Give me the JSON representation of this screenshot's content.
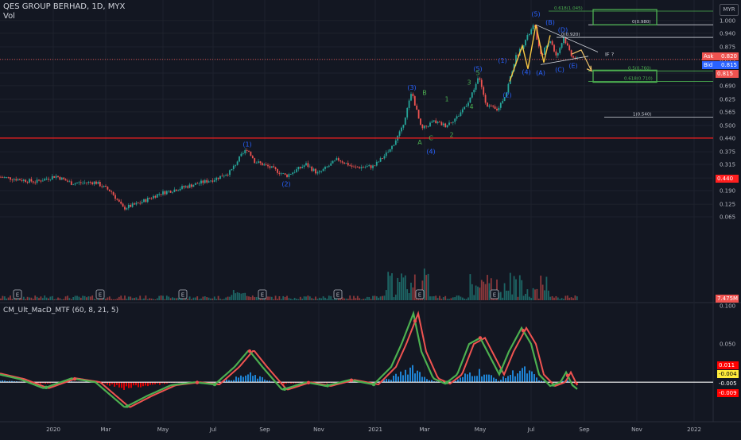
{
  "header": {
    "title": "QES GROUP BERHAD, 1D, MYX",
    "volume_label": "Vol",
    "currency": "MYR",
    "indicator_label": "CM_Ult_MacD_MTF (60, 8, 21, 5)"
  },
  "colors": {
    "background": "#131722",
    "up": "#26a69a",
    "down": "#ef5350",
    "wave_label": "#2962ff",
    "sub_wave_label": "#4caf50",
    "fib_box": "#4caf50",
    "red_line": "#ff1f1f",
    "macd_line": "#4caf50",
    "macd_signal": "#ef5350",
    "hist_up": "#2196f3",
    "hist_down": "#ff0000",
    "projection": "#f0c36a"
  },
  "price_tags": [
    {
      "label": "Ask",
      "value": "0.820",
      "color": "#ef5350"
    },
    {
      "label": "Bid",
      "value": "0.815",
      "color": "#2962ff"
    },
    {
      "label": "",
      "value": "0.815",
      "color": "#ef5350"
    },
    {
      "label": "",
      "value": "0.440",
      "color": "#ff1f1f"
    },
    {
      "label": "",
      "value": "7.475M",
      "color": "#ef5350"
    }
  ],
  "macd_tags": [
    {
      "value": "0.011",
      "color": "#ff0000",
      "text_color": "#ffffff"
    },
    {
      "value": "-0.004",
      "color": "#ffeb3b",
      "text_color": "#000000"
    },
    {
      "value": "-0.005",
      "color": "#131722",
      "text_color": "#ffffff"
    },
    {
      "value": "-0.009",
      "color": "#ff0000",
      "text_color": "#ffffff"
    }
  ],
  "fib_labels": {
    "top": "0.618(1.045)",
    "upper": "0(0.980)",
    "mid_high": "0(0.920)",
    "half": "0.5(0.760)",
    "lower": "0.618(0.710)",
    "one": "1(0.540)"
  },
  "projection_label": "IF ?",
  "earnings_marker": "E",
  "chart_data": [
    {
      "type": "candlestick",
      "title": "QES GROUP BERHAD, 1D, MYX",
      "ylim": [
        0.0,
        1.08
      ],
      "price_axis_ticks": [
        1.0,
        0.94,
        0.875,
        0.815,
        0.75,
        0.69,
        0.625,
        0.565,
        0.5,
        0.44,
        0.375,
        0.315,
        0.25,
        0.19,
        0.125,
        0.065
      ],
      "time_axis_ticks": [
        "2020",
        "Mar",
        "May",
        "Jul",
        "Sep",
        "Nov",
        "2021",
        "Mar",
        "May",
        "Jul",
        "Sep",
        "Nov",
        "2022"
      ],
      "price_path": [
        [
          0,
          0.255
        ],
        [
          20,
          0.245
        ],
        [
          45,
          0.232
        ],
        [
          70,
          0.26
        ],
        [
          90,
          0.225
        ],
        [
          120,
          0.23
        ],
        [
          140,
          0.185
        ],
        [
          155,
          0.105
        ],
        [
          175,
          0.13
        ],
        [
          200,
          0.175
        ],
        [
          240,
          0.215
        ],
        [
          270,
          0.245
        ],
        [
          290,
          0.28
        ],
        [
          300,
          0.34
        ],
        [
          311,
          0.39
        ],
        [
          320,
          0.33
        ],
        [
          340,
          0.3
        ],
        [
          360,
          0.26
        ],
        [
          385,
          0.315
        ],
        [
          400,
          0.27
        ],
        [
          425,
          0.34
        ],
        [
          445,
          0.3
        ],
        [
          470,
          0.305
        ],
        [
          490,
          0.38
        ],
        [
          505,
          0.48
        ],
        [
          518,
          0.66
        ],
        [
          530,
          0.48
        ],
        [
          545,
          0.52
        ],
        [
          560,
          0.5
        ],
        [
          575,
          0.54
        ],
        [
          590,
          0.62
        ],
        [
          602,
          0.73
        ],
        [
          612,
          0.6
        ],
        [
          625,
          0.57
        ],
        [
          637,
          0.66
        ],
        [
          648,
          0.82
        ],
        [
          660,
          0.9
        ],
        [
          672,
          0.98
        ],
        [
          680,
          0.83
        ],
        [
          692,
          0.91
        ],
        [
          700,
          0.83
        ],
        [
          709,
          0.92
        ],
        [
          718,
          0.84
        ],
        [
          726,
          0.815
        ]
      ],
      "waves": [
        {
          "label": "(1)",
          "x": 311,
          "y": 0.4
        },
        {
          "label": "(2)",
          "x": 360,
          "y": 0.21
        },
        {
          "label": "(3)",
          "x": 518,
          "y": 0.67
        },
        {
          "label": "(4)",
          "x": 542,
          "y": 0.365
        },
        {
          "label": "(5)",
          "x": 601,
          "y": 0.76
        },
        {
          "label": "(1)",
          "x": 632,
          "y": 0.8
        },
        {
          "label": "(2)",
          "x": 638,
          "y": 0.635
        },
        {
          "label": "(5)",
          "x": 674,
          "y": 1.02
        },
        {
          "label": "(4)",
          "x": 662,
          "y": 0.745
        },
        {
          "label": "(A)",
          "x": 680,
          "y": 0.74
        },
        {
          "label": "(B)",
          "x": 692,
          "y": 0.98
        },
        {
          "label": "(C)",
          "x": 704,
          "y": 0.755
        },
        {
          "label": "(D)",
          "x": 708,
          "y": 0.945
        },
        {
          "label": "(E)",
          "x": 721,
          "y": 0.775
        }
      ],
      "sub_waves": [
        {
          "label": "A",
          "x": 528,
          "y": 0.41
        },
        {
          "label": "B",
          "x": 534,
          "y": 0.645
        },
        {
          "label": "C",
          "x": 542,
          "y": 0.43
        },
        {
          "label": "1",
          "x": 562,
          "y": 0.615
        },
        {
          "label": "2",
          "x": 568,
          "y": 0.445
        },
        {
          "label": "3",
          "x": 590,
          "y": 0.695
        },
        {
          "label": "4",
          "x": 593,
          "y": 0.58
        },
        {
          "label": "5",
          "x": 601,
          "y": 0.74
        }
      ],
      "horizontal_levels": {
        "support": 0.44,
        "current": 0.815
      },
      "fib_levels": {
        "top": 1.045,
        "upper": 0.98,
        "mid_high": 0.92,
        "half": 0.76,
        "lower": 0.71,
        "one": 0.54
      }
    },
    {
      "type": "area",
      "title": "CM_Ult_MacD_MTF (60, 8, 21, 5)",
      "ylim": [
        -0.035,
        0.1
      ],
      "axis_ticks": [
        0.1,
        0.05,
        0.011,
        -0.004,
        -0.005,
        -0.009
      ],
      "macd_path": [
        [
          0,
          0.01
        ],
        [
          25,
          0.004
        ],
        [
          55,
          -0.008
        ],
        [
          90,
          0.005
        ],
        [
          120,
          0.0
        ],
        [
          157,
          -0.033
        ],
        [
          185,
          -0.018
        ],
        [
          215,
          -0.004
        ],
        [
          245,
          0.0
        ],
        [
          270,
          -0.003
        ],
        [
          295,
          0.02
        ],
        [
          313,
          0.042
        ],
        [
          330,
          0.02
        ],
        [
          355,
          -0.01
        ],
        [
          385,
          0.0
        ],
        [
          410,
          -0.005
        ],
        [
          440,
          0.003
        ],
        [
          470,
          -0.003
        ],
        [
          492,
          0.02
        ],
        [
          505,
          0.05
        ],
        [
          520,
          0.09
        ],
        [
          530,
          0.04
        ],
        [
          545,
          0.005
        ],
        [
          560,
          -0.002
        ],
        [
          575,
          0.01
        ],
        [
          590,
          0.05
        ],
        [
          604,
          0.058
        ],
        [
          618,
          0.03
        ],
        [
          628,
          0.01
        ],
        [
          640,
          0.04
        ],
        [
          656,
          0.071
        ],
        [
          668,
          0.05
        ],
        [
          678,
          0.01
        ],
        [
          692,
          -0.005
        ],
        [
          705,
          0.0
        ],
        [
          712,
          0.013
        ],
        [
          720,
          -0.004
        ],
        [
          726,
          -0.009
        ]
      ]
    }
  ]
}
